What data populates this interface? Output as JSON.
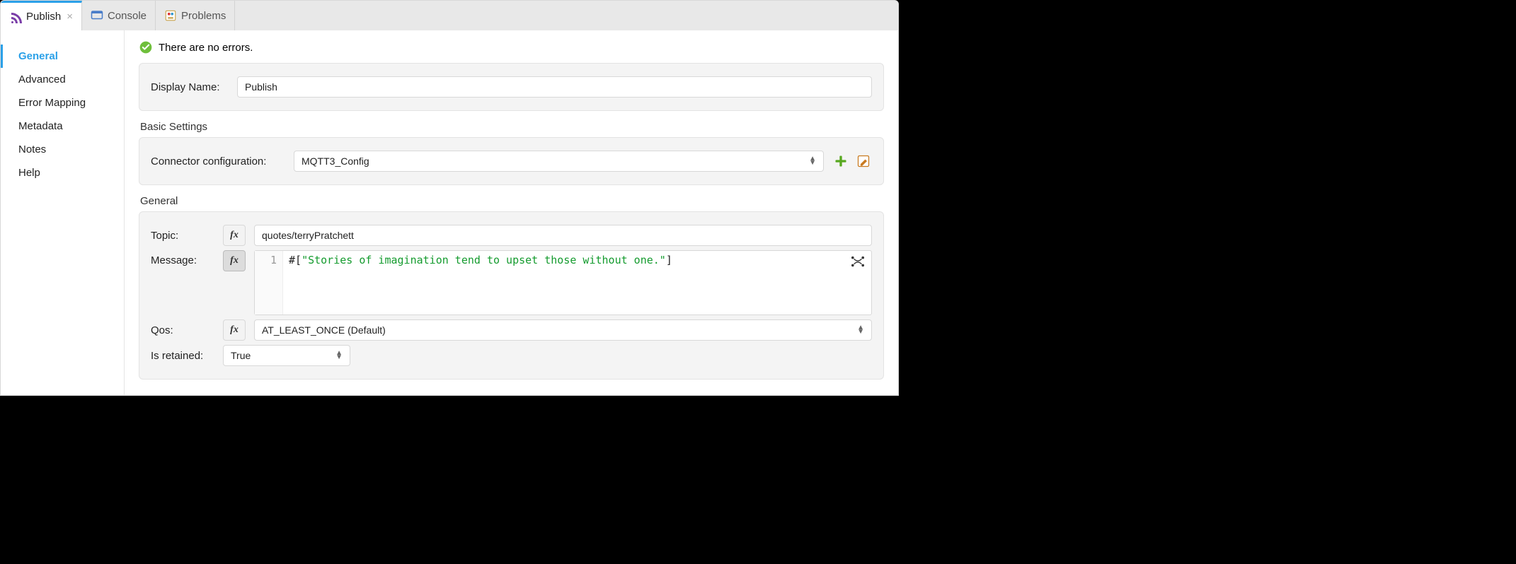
{
  "tabs": {
    "publish": "Publish",
    "console": "Console",
    "problems": "Problems"
  },
  "sidebar": {
    "items": [
      "General",
      "Advanced",
      "Error Mapping",
      "Metadata",
      "Notes",
      "Help"
    ],
    "active": "General"
  },
  "status": {
    "message": "There are no errors."
  },
  "displayName": {
    "label": "Display Name:",
    "value": "Publish"
  },
  "basicSettings": {
    "title": "Basic Settings",
    "connectorLabel": "Connector configuration:",
    "connectorValue": "MQTT3_Config"
  },
  "general": {
    "title": "General",
    "topicLabel": "Topic:",
    "topicValue": "quotes/terryPratchett",
    "messageLabel": "Message:",
    "message": {
      "lineNo": "1",
      "prefix": "#[",
      "string": "\"Stories of imagination tend to upset those without one.\"",
      "suffix": "]"
    },
    "qosLabel": "Qos:",
    "qosValue": "AT_LEAST_ONCE (Default)",
    "retainedLabel": "Is retained:",
    "retainedValue": "True"
  },
  "fxLabel": "fx"
}
